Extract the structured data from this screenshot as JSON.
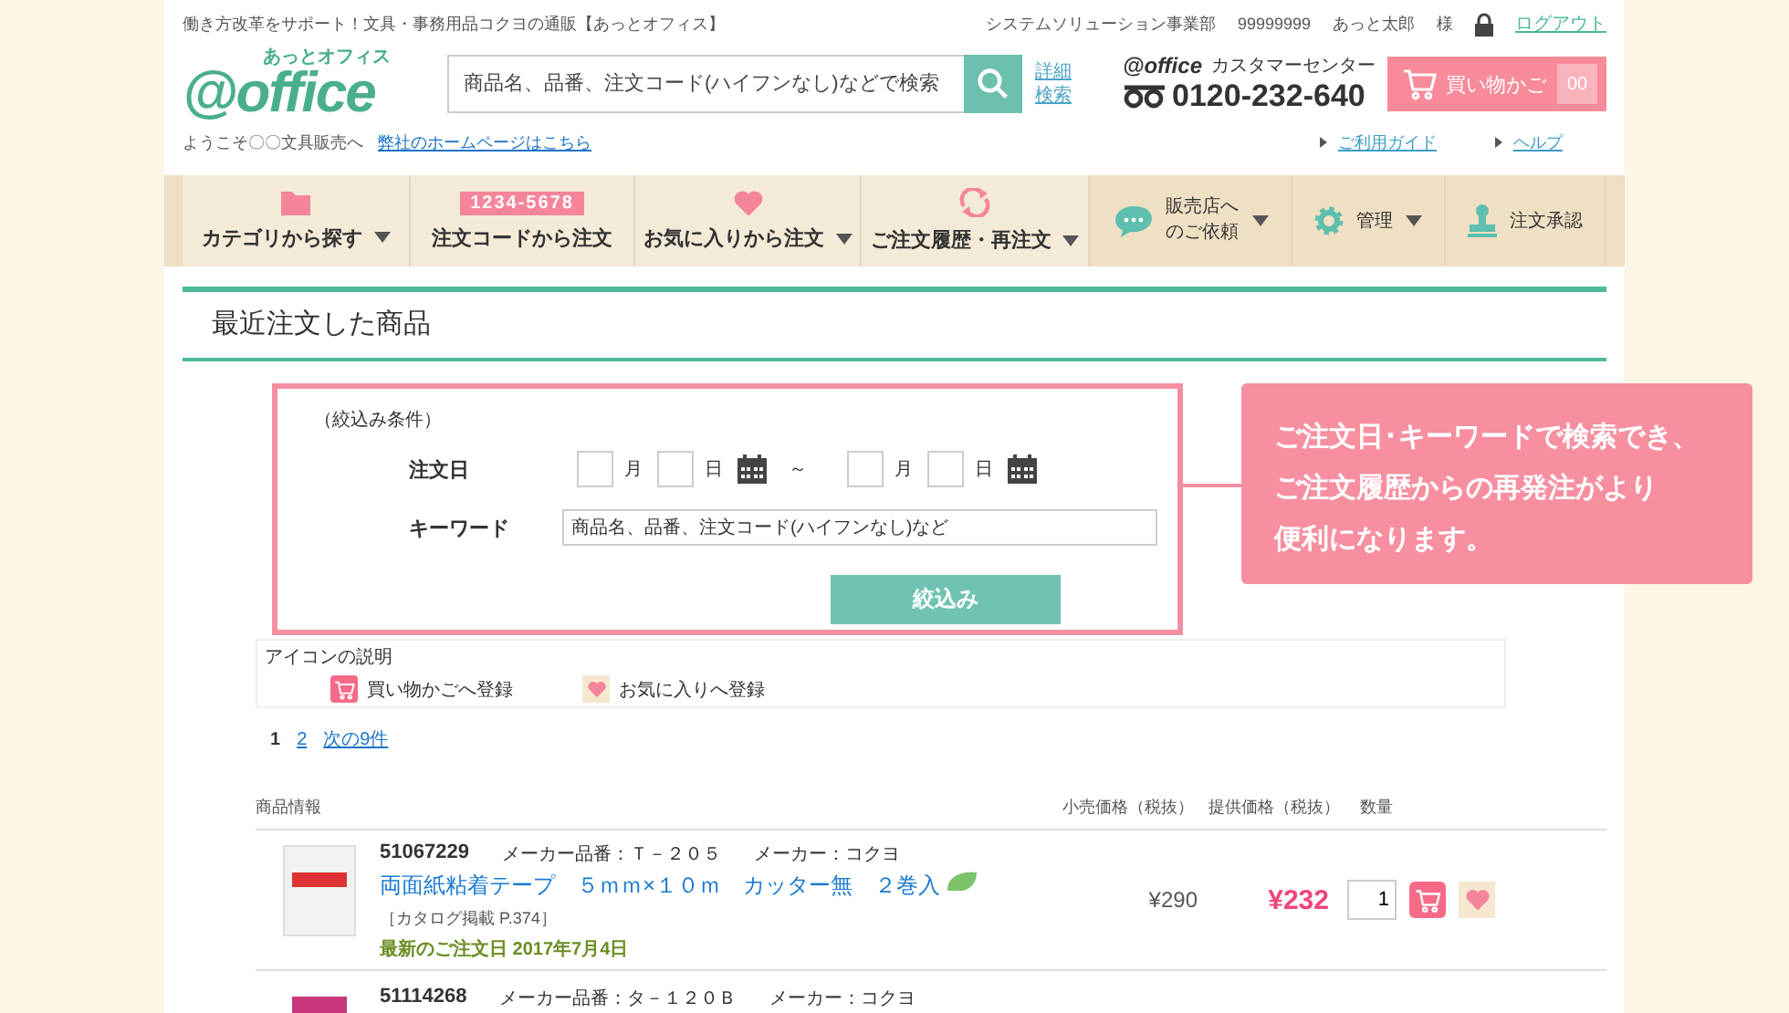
{
  "header": {
    "tagline": "働き方改革をサポート！文具・事務用品コクヨの通販【あっとオフィス】",
    "user": {
      "department": "システムソリューション事業部",
      "id": "99999999",
      "name": "あっと太郎",
      "honorific": "様"
    },
    "logout": "ログアウト",
    "logo": {
      "text": "@office",
      "reading_left": "あっと",
      "reading_right": "オフィス"
    },
    "search": {
      "placeholder": "商品名、品番、注文コード(ハイフンなし)などで検索"
    },
    "advanced_search": "詳細検索",
    "customer_center": {
      "logo": "@office",
      "label": "カスタマーセンター",
      "phone": "0120-232-640"
    },
    "cart": {
      "label": "買い物かご",
      "count": "00"
    },
    "welcome": "ようこそ〇〇文具販売へ",
    "company_link": "弊社のホームページはこちら",
    "links": [
      "ご利用ガイド",
      "ヘルプ"
    ]
  },
  "nav": [
    {
      "kind": "folder",
      "label": "カテゴリから探す",
      "dropdown": true,
      "secondary": false
    },
    {
      "kind": "code",
      "badge": "1234-5678",
      "label": "注文コードから注文",
      "dropdown": false,
      "secondary": false
    },
    {
      "kind": "heart",
      "label": "お気に入りから注文",
      "dropdown": true,
      "secondary": false
    },
    {
      "kind": "repeat",
      "label": "ご注文履歴・再注文",
      "dropdown": true,
      "secondary": false
    },
    {
      "kind": "chat",
      "label": "販売店へのご依頼",
      "dropdown": true,
      "secondary": true
    },
    {
      "kind": "gear",
      "label": "管理",
      "dropdown": true,
      "secondary": true
    },
    {
      "kind": "stamp",
      "label": "注文承認",
      "dropdown": false,
      "secondary": true
    }
  ],
  "section": {
    "title": "最近注文した商品"
  },
  "filter": {
    "caption": "（絞込み条件）",
    "date_label": "注文日",
    "from": {
      "month": "月",
      "day": "日"
    },
    "separator": "～",
    "to": {
      "month": "月",
      "day": "日"
    },
    "keyword_label": "キーワード",
    "keyword_placeholder": "商品名、品番、注文コード(ハイフンなし)など",
    "button": "絞込み"
  },
  "callout": {
    "lines": [
      "ご注文日･キーワードで検索でき、",
      "ご注文履歴からの再発注がより",
      "便利になります。"
    ]
  },
  "legend": {
    "title": "アイコンの説明",
    "items": [
      {
        "kind": "cart",
        "label": "買い物かごへ登録"
      },
      {
        "kind": "favorite",
        "label": "お気に入りへ登録"
      }
    ]
  },
  "pagination": [
    {
      "label": "1",
      "selected": true
    },
    {
      "label": "2",
      "selected": false
    },
    {
      "label": "次の9件",
      "selected": false
    }
  ],
  "table": {
    "columns": [
      "商品情報",
      "小売価格（税抜）",
      "提供価格（税抜）",
      "数量"
    ],
    "rows": [
      {
        "number": "51067229",
        "maker_part": "メーカー品番：Ｔ－２０５",
        "maker": "メーカー：コクヨ",
        "name": "両面紙粘着テープ　５ｍｍ×１０ｍ　カッター無　２巻入",
        "eco": true,
        "catalog": "［カタログ掲載 P.374］",
        "last_order": "最新のご注文日 2017年7月4日",
        "retail": "¥290",
        "price": "¥232",
        "quantity": "1"
      },
      {
        "number": "51114268",
        "maker_part": "メーカー品番：タ－１２０Ｂ",
        "maker": "メーカー：コクヨ"
      }
    ]
  }
}
